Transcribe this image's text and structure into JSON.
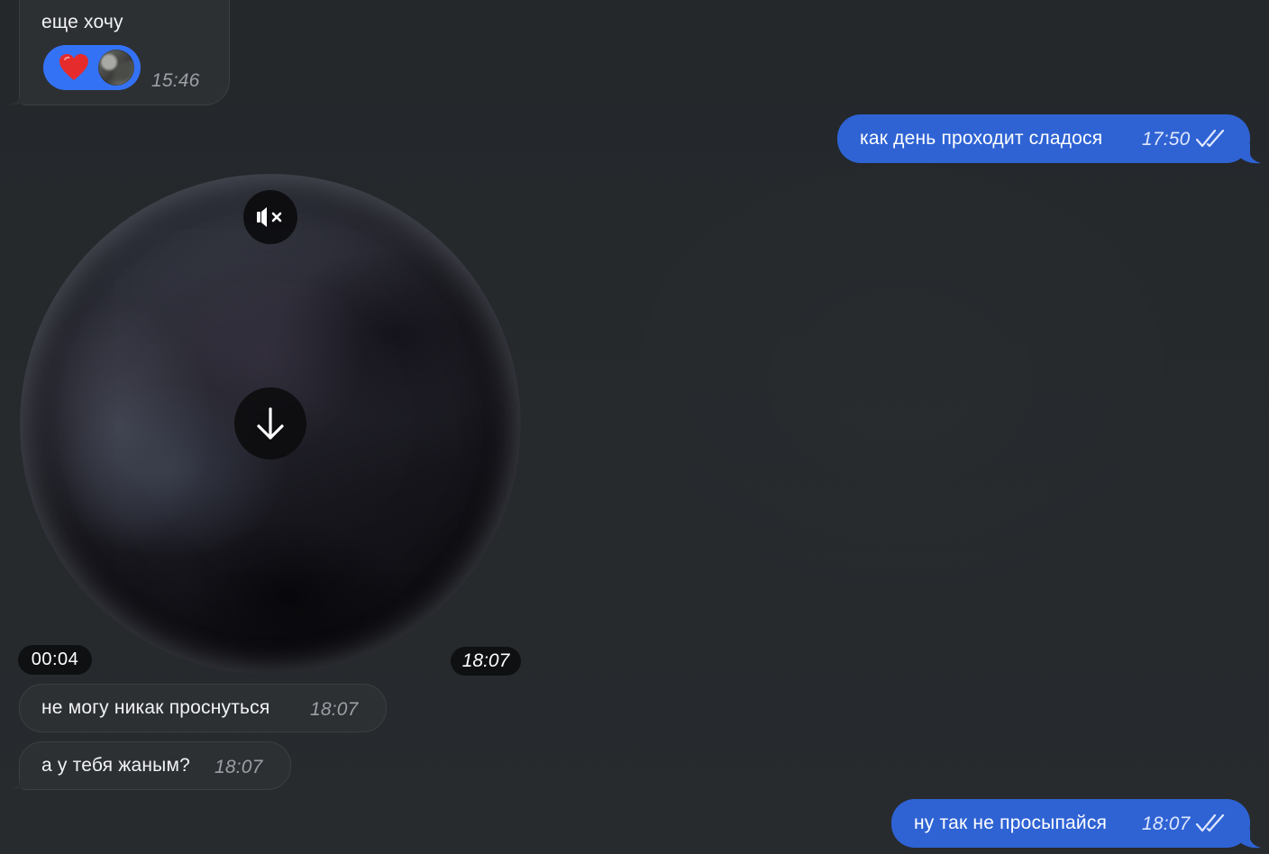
{
  "messages": [
    {
      "id": "msg1",
      "direction": "incoming",
      "text": "еще хочу",
      "time": "15:46",
      "reaction": {
        "emoji_icon": "heart-icon",
        "color": "#e52b2b",
        "pill_color": "#3472f5",
        "avatar": "reactor-avatar"
      }
    },
    {
      "id": "msg2",
      "direction": "outgoing",
      "text": "как день проходит сладося",
      "time": "17:50",
      "status_icon": "double-check-icon"
    },
    {
      "id": "msg3",
      "direction": "incoming",
      "type": "video_message",
      "duration": "00:04",
      "time": "18:07",
      "mute_icon": "muted-speaker-icon",
      "download_icon": "download-arrow-icon"
    },
    {
      "id": "msg4",
      "direction": "incoming",
      "text": "не могу никак проснуться",
      "time": "18:07"
    },
    {
      "id": "msg5",
      "direction": "incoming",
      "text": "а у тебя жаным?",
      "time": "18:07"
    },
    {
      "id": "msg6",
      "direction": "outgoing",
      "text": "ну так не просыпайся",
      "time": "18:07",
      "status_icon": "double-check-icon"
    }
  ],
  "colors": {
    "background": "#262a2d",
    "incoming_bubble": "#2d3033",
    "outgoing_bubble": "#2f63d4"
  }
}
